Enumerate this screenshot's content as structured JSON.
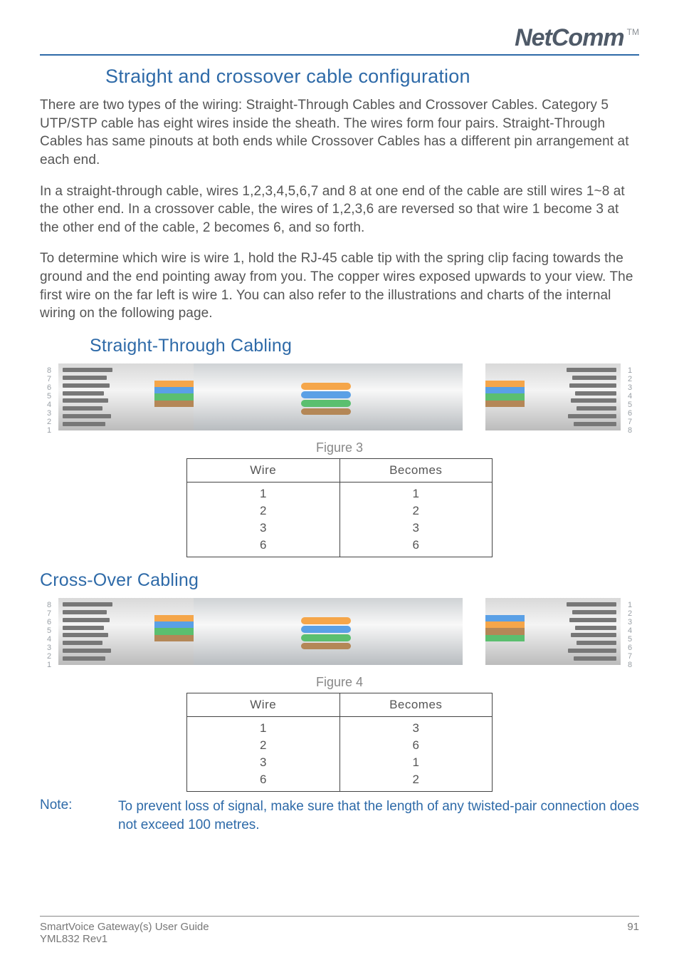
{
  "brand": {
    "name": "NetComm",
    "tm": "TM"
  },
  "headings": {
    "section": "Straight and crossover cable configuration",
    "straight": "Straight-Through Cabling",
    "crossover": "Cross-Over Cabling"
  },
  "paragraphs": {
    "p1": "There are two types of the wiring: Straight-Through Cables and Crossover Cables. Category 5 UTP/STP cable has eight wires inside the sheath. The wires form four pairs. Straight-Through Cables has same pinouts at both ends while Crossover Cables has a different pin arrangement at each end.",
    "p2": "In a straight-through cable, wires 1,2,3,4,5,6,7 and 8 at one end of the cable are still wires 1~8 at the other end. In a crossover cable, the wires of 1,2,3,6 are reversed so that wire 1 become 3 at the other end of the cable, 2 becomes 6, and so forth.",
    "p3": "To determine which wire is wire 1, hold the RJ-45 cable tip with the spring clip facing towards the ground and the end pointing away from you. The copper wires exposed upwards to your view. The first wire on the far left is wire 1. You can also refer to the illustrations and charts of the internal wiring on the following page."
  },
  "pin_labels_desc": [
    "8",
    "7",
    "6",
    "5",
    "4",
    "3",
    "2",
    "1"
  ],
  "pin_labels_asc": [
    "1",
    "2",
    "3",
    "4",
    "5",
    "6",
    "7",
    "8"
  ],
  "figures": {
    "fig3": {
      "caption": "Figure 3"
    },
    "fig4": {
      "caption": "Figure 4"
    }
  },
  "tables": {
    "headers": {
      "wire": "Wire",
      "becomes": "Becomes"
    },
    "straight": [
      {
        "wire": "1",
        "becomes": "1"
      },
      {
        "wire": "2",
        "becomes": "2"
      },
      {
        "wire": "3",
        "becomes": "3"
      },
      {
        "wire": "6",
        "becomes": "6"
      }
    ],
    "crossover": [
      {
        "wire": "1",
        "becomes": "3"
      },
      {
        "wire": "2",
        "becomes": "6"
      },
      {
        "wire": "3",
        "becomes": "1"
      },
      {
        "wire": "6",
        "becomes": "2"
      }
    ]
  },
  "note": {
    "label": "Note:",
    "text": "To prevent loss of signal, make sure that the length of any twisted-pair connection does not exceed 100 metres."
  },
  "footer": {
    "title": "SmartVoice Gateway(s) User Guide",
    "rev": "YML832 Rev1",
    "page": "91"
  }
}
